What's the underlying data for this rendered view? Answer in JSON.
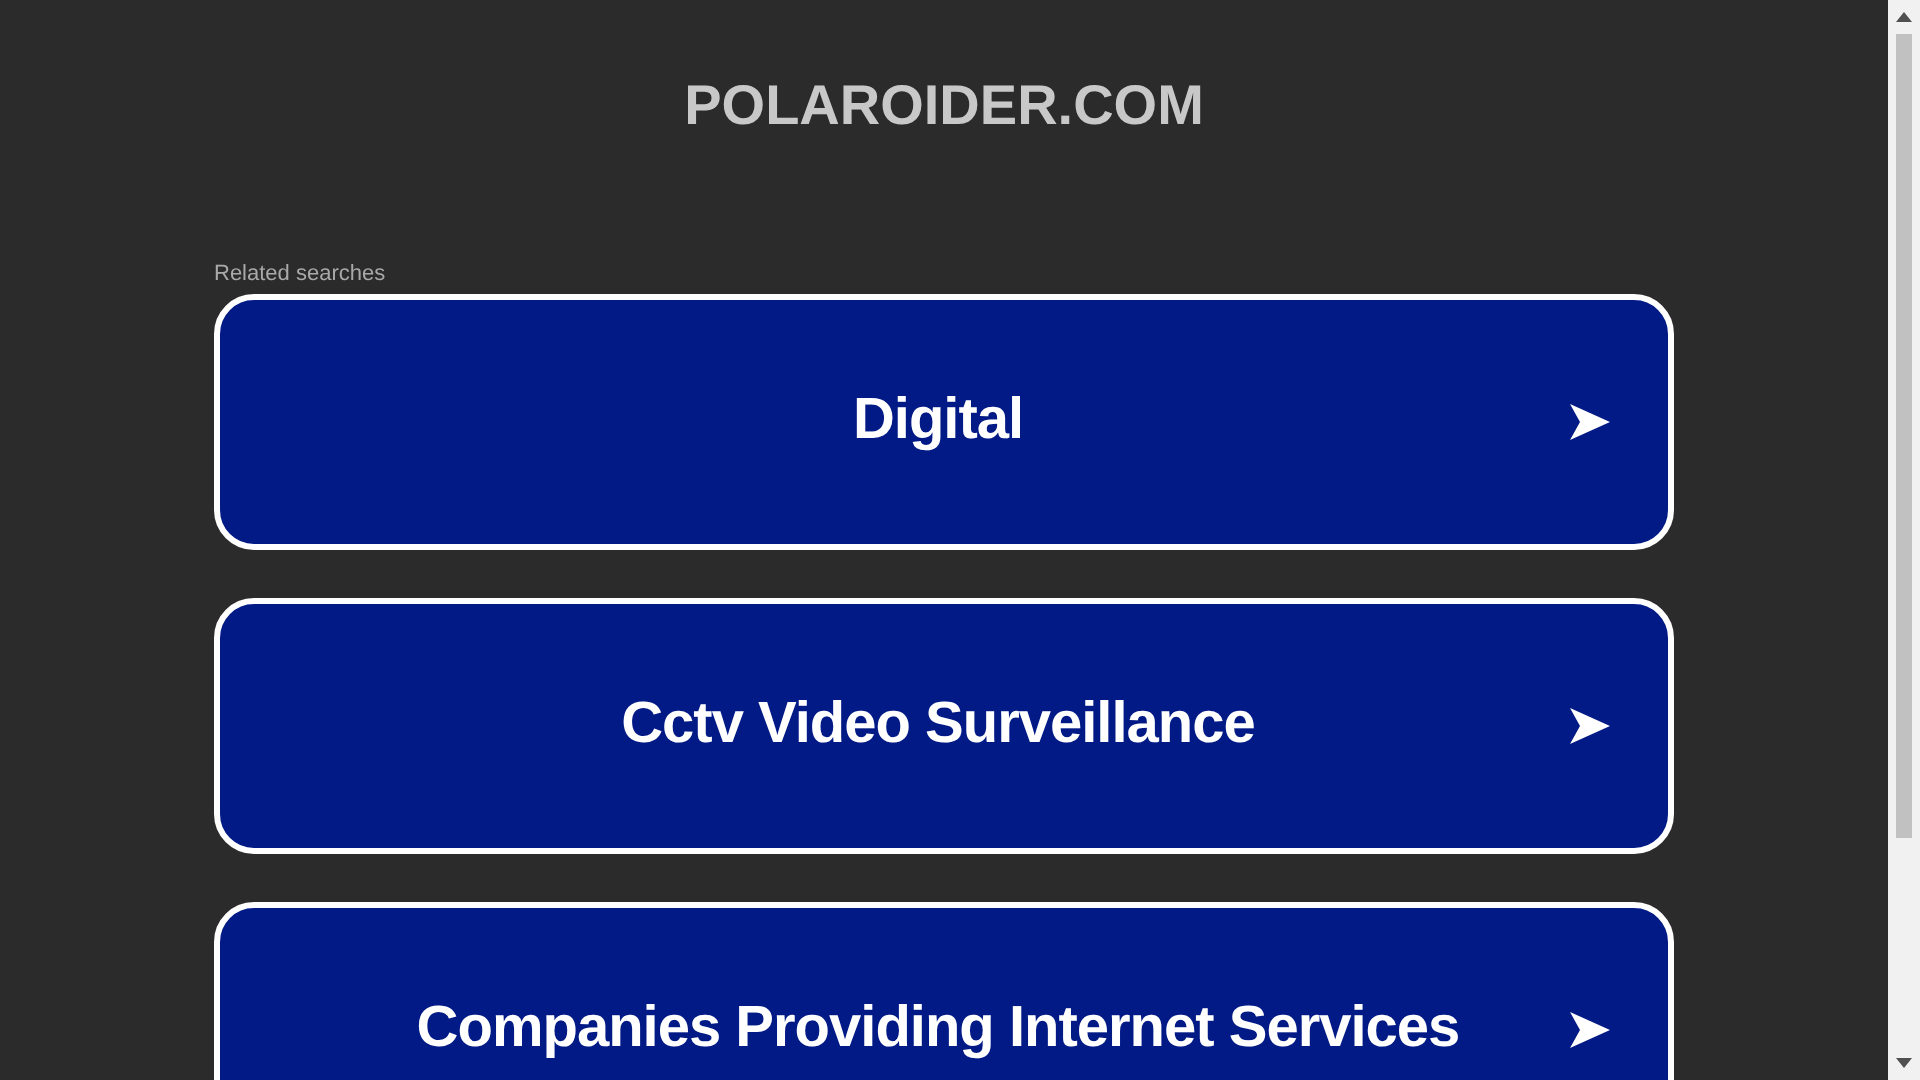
{
  "site_title": "POLAROIDER.COM",
  "related_label": "Related searches",
  "links": [
    {
      "label": "Digital"
    },
    {
      "label": "Cctv Video Surveillance"
    },
    {
      "label": "Companies Providing Internet Services"
    }
  ]
}
